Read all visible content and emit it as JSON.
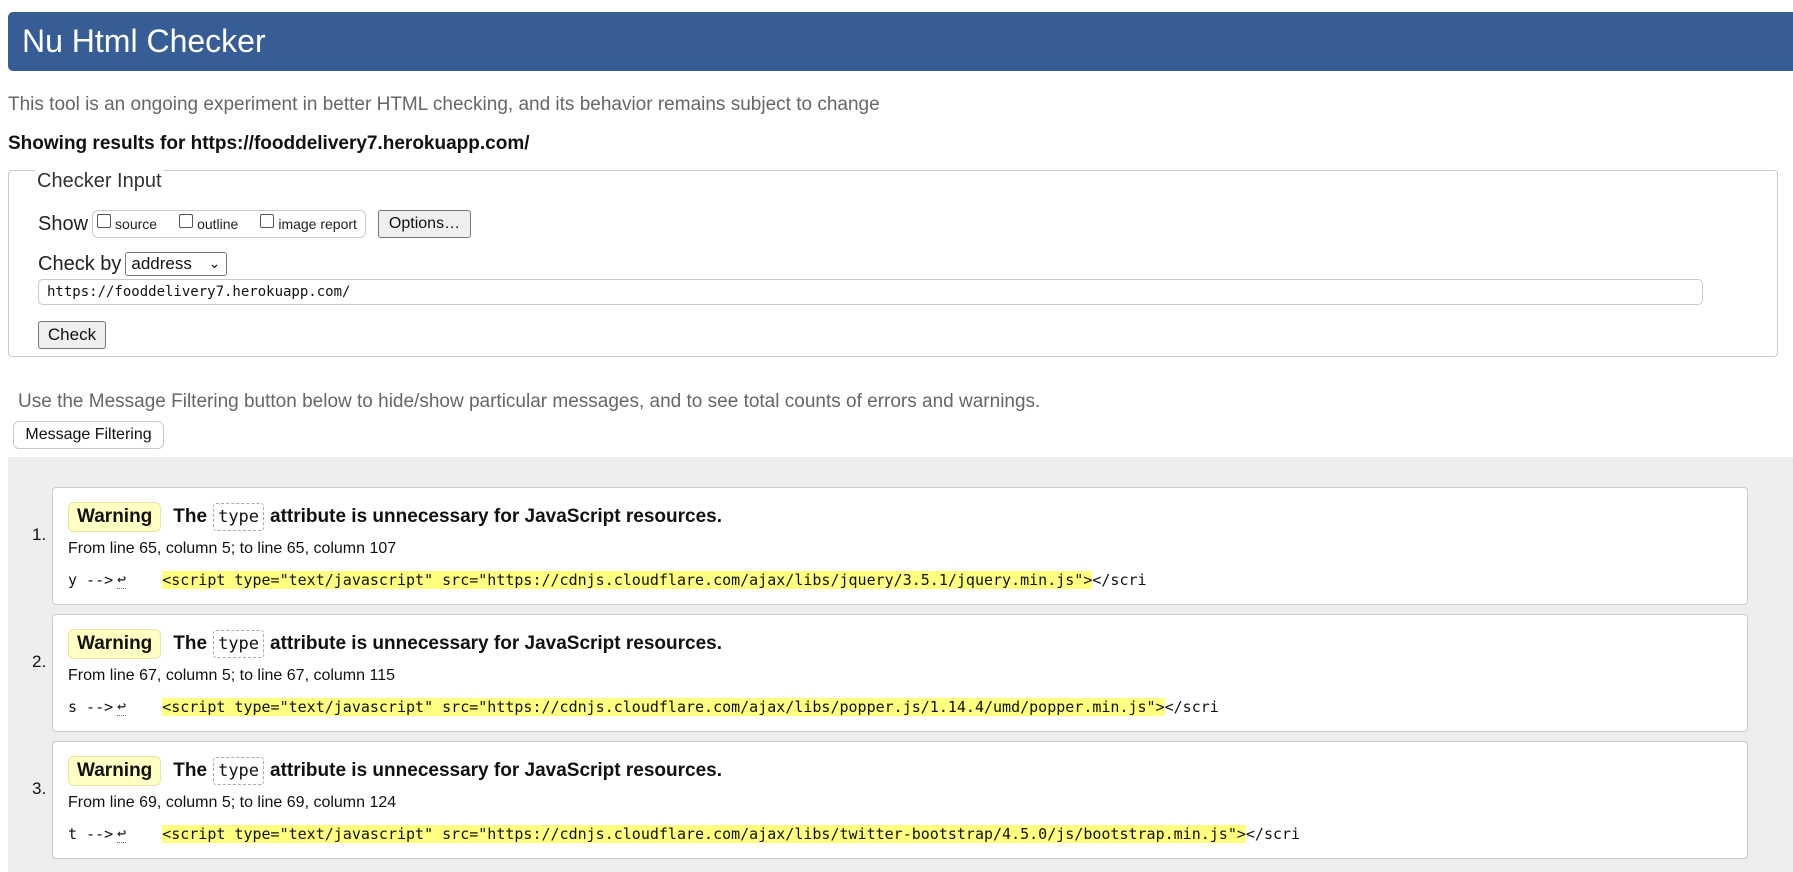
{
  "header": {
    "title": "Nu Html Checker"
  },
  "tagline": "This tool is an ongoing experiment in better HTML checking, and its behavior remains subject to change",
  "results_for": "Showing results for https://fooddelivery7.herokuapp.com/",
  "checker": {
    "legend": "Checker Input",
    "show_label": "Show",
    "options": [
      {
        "label": "source",
        "checked": false
      },
      {
        "label": "outline",
        "checked": false
      },
      {
        "label": "image report",
        "checked": false
      }
    ],
    "options_button": "Options…",
    "check_by_label": "Check by",
    "check_by_value": "address",
    "url_value": "https://fooddelivery7.herokuapp.com/",
    "check_button": "Check"
  },
  "filter": {
    "hint": "Use the Message Filtering button below to hide/show particular messages, and to see total counts of errors and warnings.",
    "button": "Message Filtering"
  },
  "messages": [
    {
      "number": "1.",
      "type": "Warning",
      "title_pre": "The",
      "title_code": "type",
      "title_post": "attribute is unnecessary for JavaScript resources.",
      "location": "From line 65, column 5; to line 65, column 107",
      "extract_pre": "y -->",
      "extract_ret": "↩",
      "extract_highlight": "<script type=\"text/javascript\" src=\"https://cdnjs.cloudflare.com/ajax/libs/jquery/3.5.1/jquery.min.js\">",
      "extract_post": "</scri"
    },
    {
      "number": "2.",
      "type": "Warning",
      "title_pre": "The",
      "title_code": "type",
      "title_post": "attribute is unnecessary for JavaScript resources.",
      "location": "From line 67, column 5; to line 67, column 115",
      "extract_pre": "s -->",
      "extract_ret": "↩",
      "extract_highlight": "<script type=\"text/javascript\" src=\"https://cdnjs.cloudflare.com/ajax/libs/popper.js/1.14.4/umd/popper.min.js\">",
      "extract_post": "</scri"
    },
    {
      "number": "3.",
      "type": "Warning",
      "title_pre": "The",
      "title_code": "type",
      "title_post": "attribute is unnecessary for JavaScript resources.",
      "location": "From line 69, column 5; to line 69, column 124",
      "extract_pre": "t -->",
      "extract_ret": "↩",
      "extract_highlight": "<script type=\"text/javascript\" src=\"https://cdnjs.cloudflare.com/ajax/libs/twitter-bootstrap/4.5.0/js/bootstrap.min.js\">",
      "extract_post": "</scri"
    }
  ]
}
